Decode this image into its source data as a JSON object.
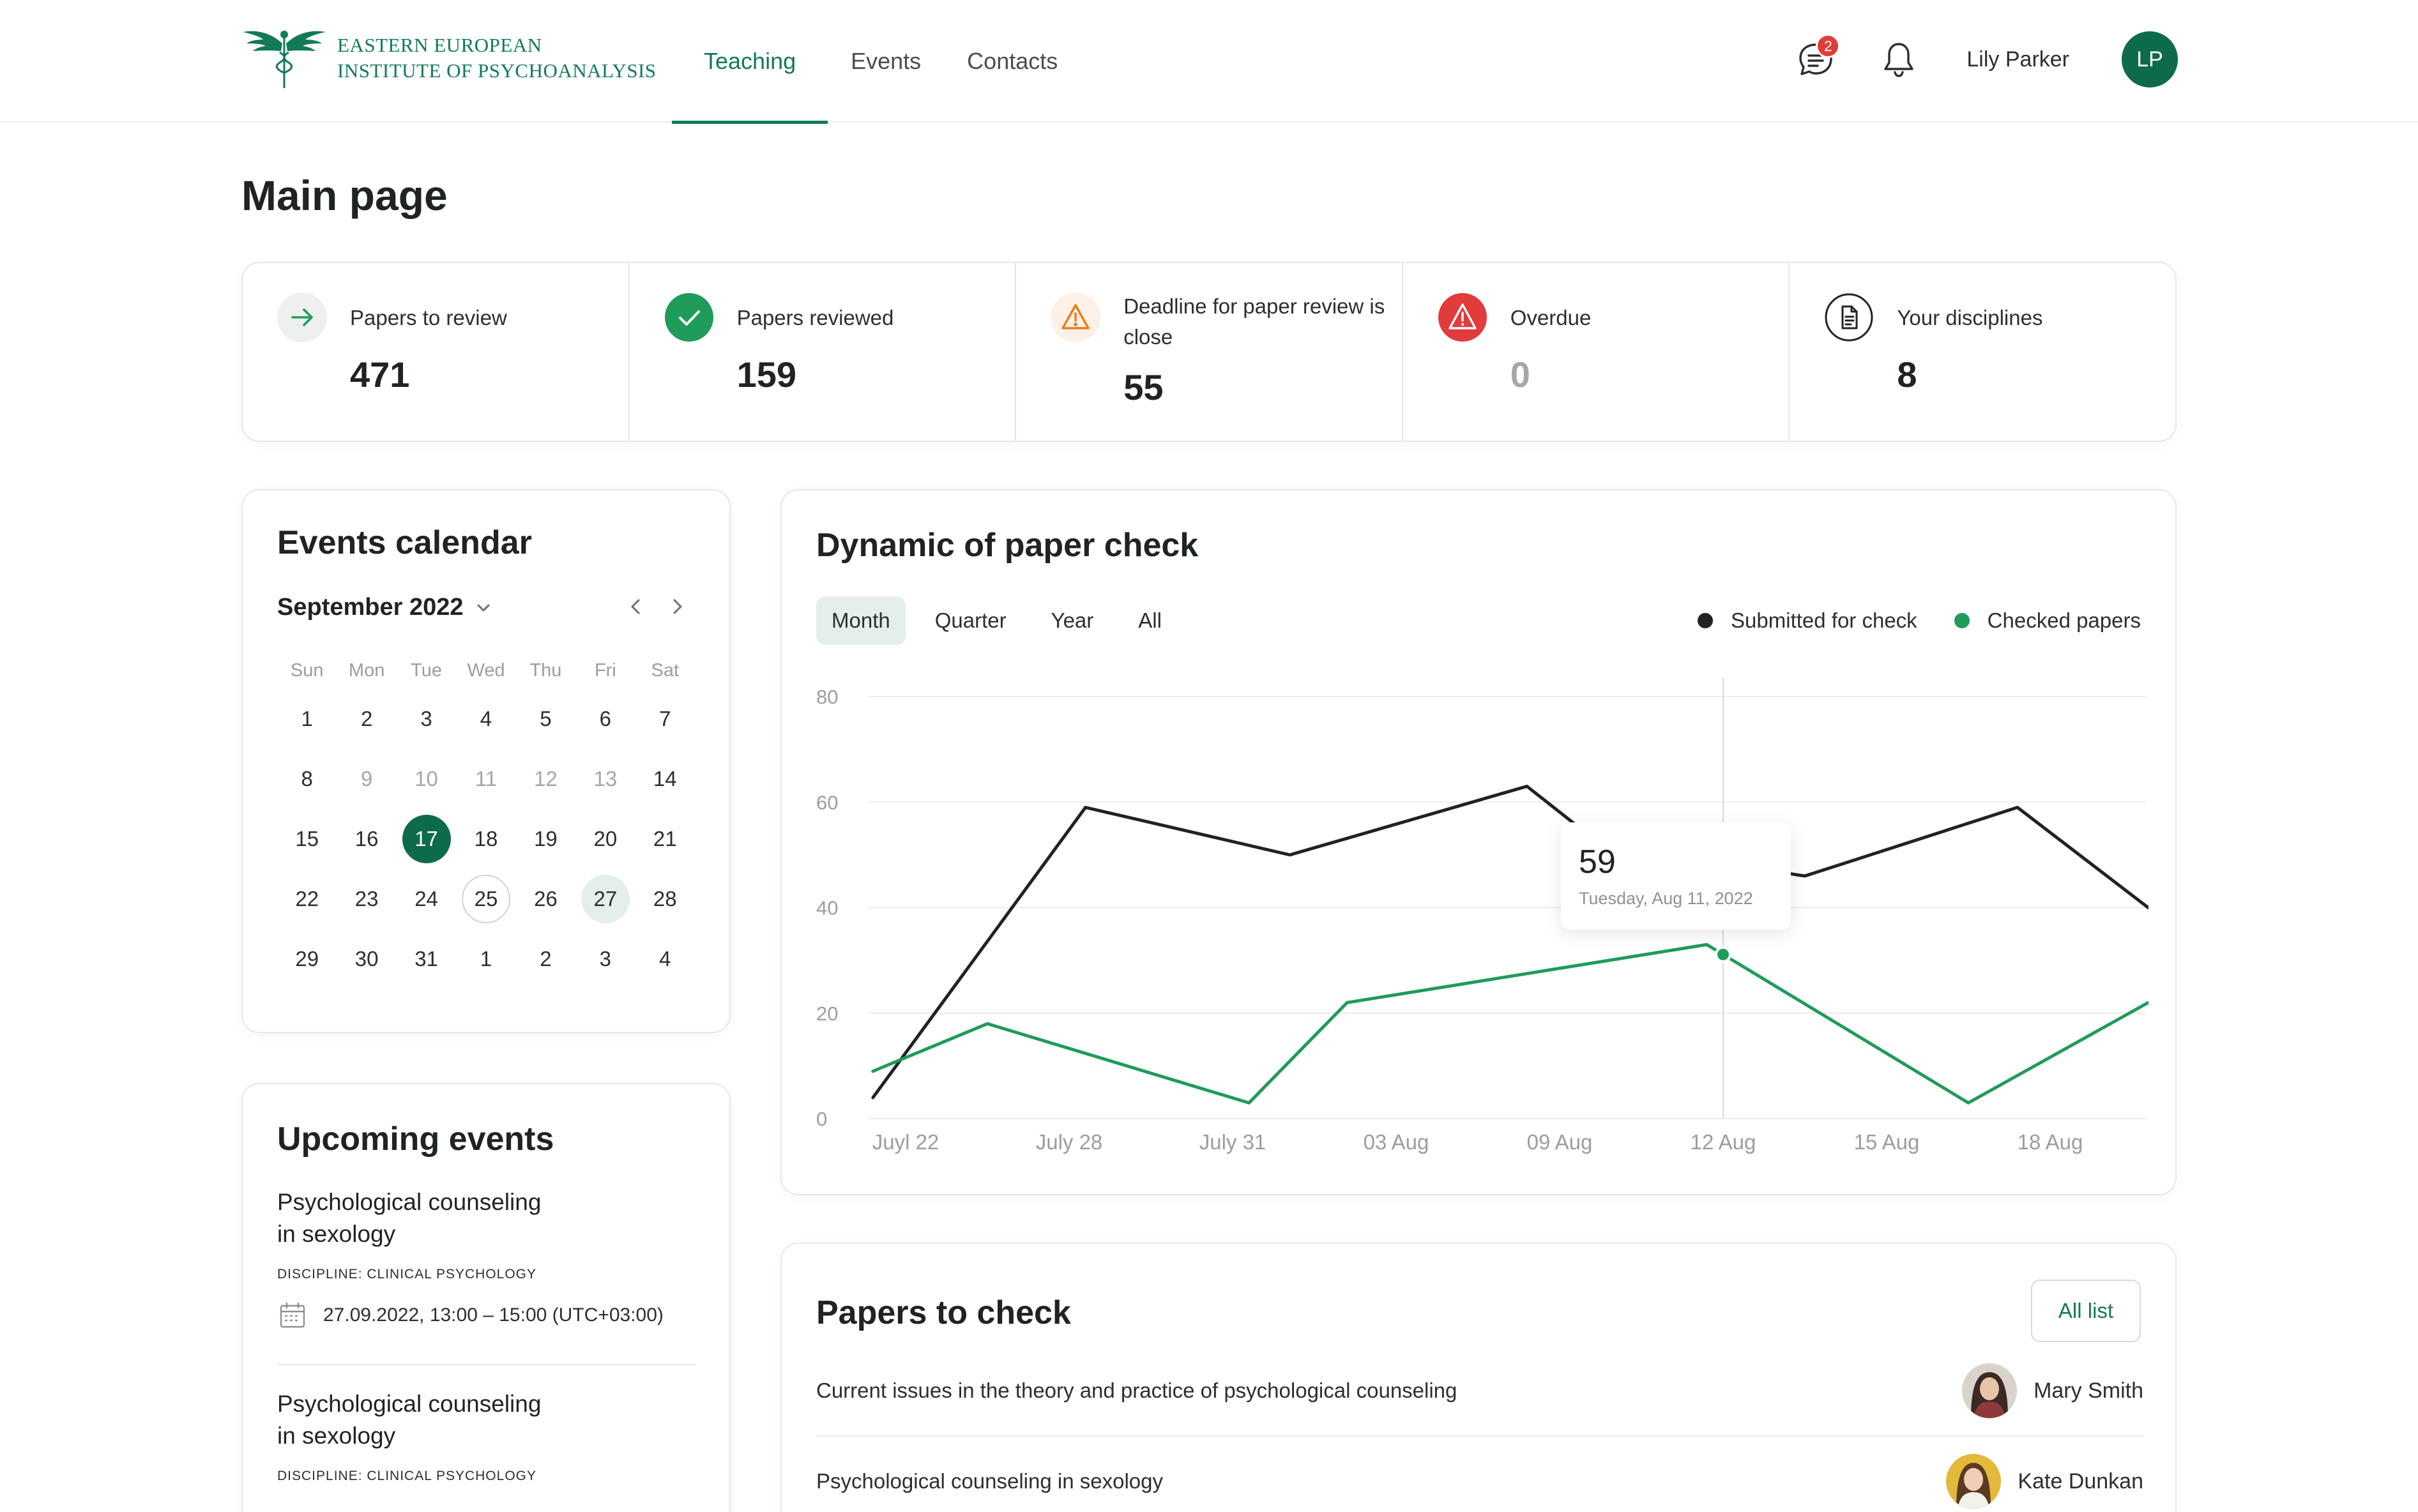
{
  "header": {
    "logo_line1": "EASTERN EUROPEAN",
    "logo_line2": "INSTITUTE OF PSYCHOANALYSIS",
    "nav": [
      "Teaching",
      "Events",
      "Contacts"
    ],
    "messages_badge": "2",
    "user_name": "Lily Parker",
    "user_initials": "LP"
  },
  "page_title": "Main page",
  "stats": [
    {
      "label": "Papers to review",
      "value": "471",
      "icon": "arrow-right-icon"
    },
    {
      "label": "Papers reviewed",
      "value": "159",
      "icon": "check-circle-icon"
    },
    {
      "label": "Deadline for paper review is close",
      "value": "55",
      "icon": "warning-icon"
    },
    {
      "label": "Overdue",
      "value": "0",
      "icon": "alert-triangle-icon"
    },
    {
      "label": "Your disciplines",
      "value": "8",
      "icon": "document-icon"
    }
  ],
  "calendar": {
    "title": "Events calendar",
    "month": "September 2022",
    "weekdays": [
      "Sun",
      "Mon",
      "Tue",
      "Wed",
      "Thu",
      "Fri",
      "Sat"
    ],
    "days": [
      "1",
      "2",
      "3",
      "4",
      "5",
      "6",
      "7",
      "8",
      "9",
      "10",
      "11",
      "12",
      "13",
      "14",
      "15",
      "16",
      "17",
      "18",
      "19",
      "20",
      "21",
      "22",
      "23",
      "24",
      "25",
      "26",
      "27",
      "28",
      "29",
      "30",
      "31",
      "1",
      "2",
      "3",
      "4"
    ],
    "selected_day": "17"
  },
  "upcoming": {
    "title": "Upcoming events",
    "events": [
      {
        "title_line1": "Psychological counseling",
        "title_line2": "in sexology",
        "discipline": "DISCIPLINE: CLINICAL PSYCHOLOGY",
        "date": "27.09.2022, 13:00 – 15:00 (UTC+03:00)"
      },
      {
        "title_line1": "Psychological counseling",
        "title_line2": "in sexology",
        "discipline": "DISCIPLINE: CLINICAL PSYCHOLOGY"
      }
    ]
  },
  "chart_card": {
    "title": "Dynamic of paper check",
    "tabs": [
      "Month",
      "Quarter",
      "Year",
      "All"
    ],
    "active_tab": "Month",
    "legend": [
      {
        "name": "Submitted for check",
        "color": "#1f2322"
      },
      {
        "name": "Checked papers",
        "color": "#1f9b5a"
      }
    ],
    "tooltip_value": "59",
    "tooltip_date": "Tuesday, Aug 11, 2022"
  },
  "chart_data": {
    "type": "line",
    "title": "Dynamic of paper check",
    "x_tick_labels": [
      "Juyl 22",
      "July 28",
      "July  31",
      "03 Aug",
      "09 Aug",
      "12 Aug",
      "15 Aug",
      "18 Aug"
    ],
    "ylim": [
      0,
      80
    ],
    "yticks": [
      0,
      20,
      40,
      60,
      80
    ],
    "grid": true,
    "legend_position": "top-right",
    "series": [
      {
        "name": "Submitted for check",
        "color": "#1f2322",
        "x_index": [
          -0.2,
          1.1,
          2.35,
          3.8,
          4.25,
          5.5,
          6.8,
          7.6
        ],
        "values": [
          4,
          59,
          50,
          63,
          52,
          46,
          59,
          40
        ]
      },
      {
        "name": "Checked papers",
        "color": "#1f9b5a",
        "x_index": [
          -0.2,
          0.5,
          2.1,
          2.7,
          4.9,
          6.5,
          7.6
        ],
        "values": [
          9,
          18,
          3,
          22,
          33,
          3,
          22
        ]
      }
    ],
    "highlight": {
      "x_label": "12 Aug",
      "value": 59,
      "date": "Tuesday, Aug 11, 2022"
    }
  },
  "papers": {
    "title": "Papers to check",
    "all_button": "All list",
    "rows": [
      {
        "title": "Current issues in the theory and practice of psychological counseling",
        "user": "Mary Smith"
      },
      {
        "title": "Psychological counseling in sexology",
        "user": "Kate Dunkan"
      }
    ]
  }
}
